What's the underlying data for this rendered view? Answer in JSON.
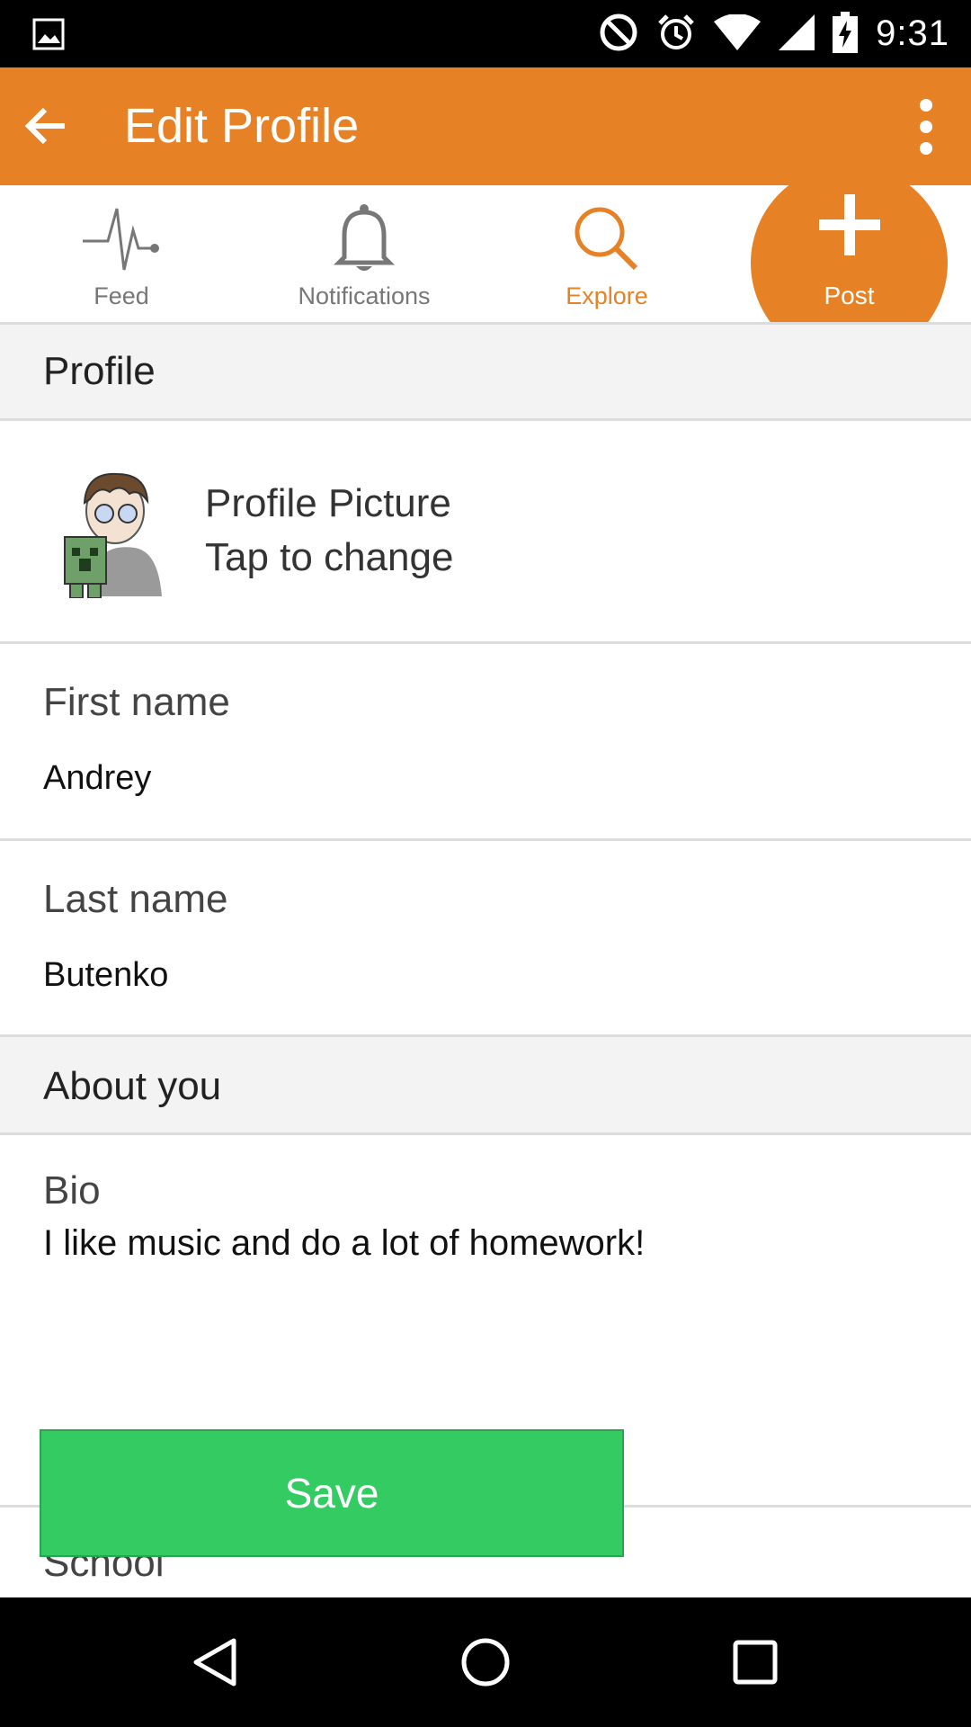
{
  "status_bar": {
    "time": "9:31",
    "icons": [
      "image-icon",
      "do-not-disturb-icon",
      "alarm-icon",
      "wifi-icon",
      "signal-icon",
      "battery-charging-icon"
    ]
  },
  "toolbar": {
    "title": "Edit Profile",
    "back_icon": "arrow-back-icon",
    "more_icon": "more-vert-icon",
    "background": "#E68225"
  },
  "tabs": [
    {
      "label": "Feed",
      "icon": "pulse-icon",
      "active": false
    },
    {
      "label": "Notifications",
      "icon": "bell-icon",
      "active": false
    },
    {
      "label": "Explore",
      "icon": "search-icon",
      "active": true
    },
    {
      "label": "Post",
      "icon": "plus-icon",
      "active": false
    }
  ],
  "profile_section": {
    "header": "Profile",
    "picture_title": "Profile Picture",
    "picture_hint": "Tap to change"
  },
  "fields": {
    "first_name_label": "First name",
    "first_name_value": "Andrey",
    "last_name_label": "Last name",
    "last_name_value": "Butenko"
  },
  "about_section": {
    "header": "About you",
    "bio_label": "Bio",
    "bio_value": "I like music and do a lot of homework!",
    "school_label": "School"
  },
  "save_button": {
    "label": "Save",
    "color": "#35CB63"
  },
  "nav_bar": {
    "icons": [
      "nav-back-icon",
      "nav-home-icon",
      "nav-recents-icon"
    ]
  }
}
